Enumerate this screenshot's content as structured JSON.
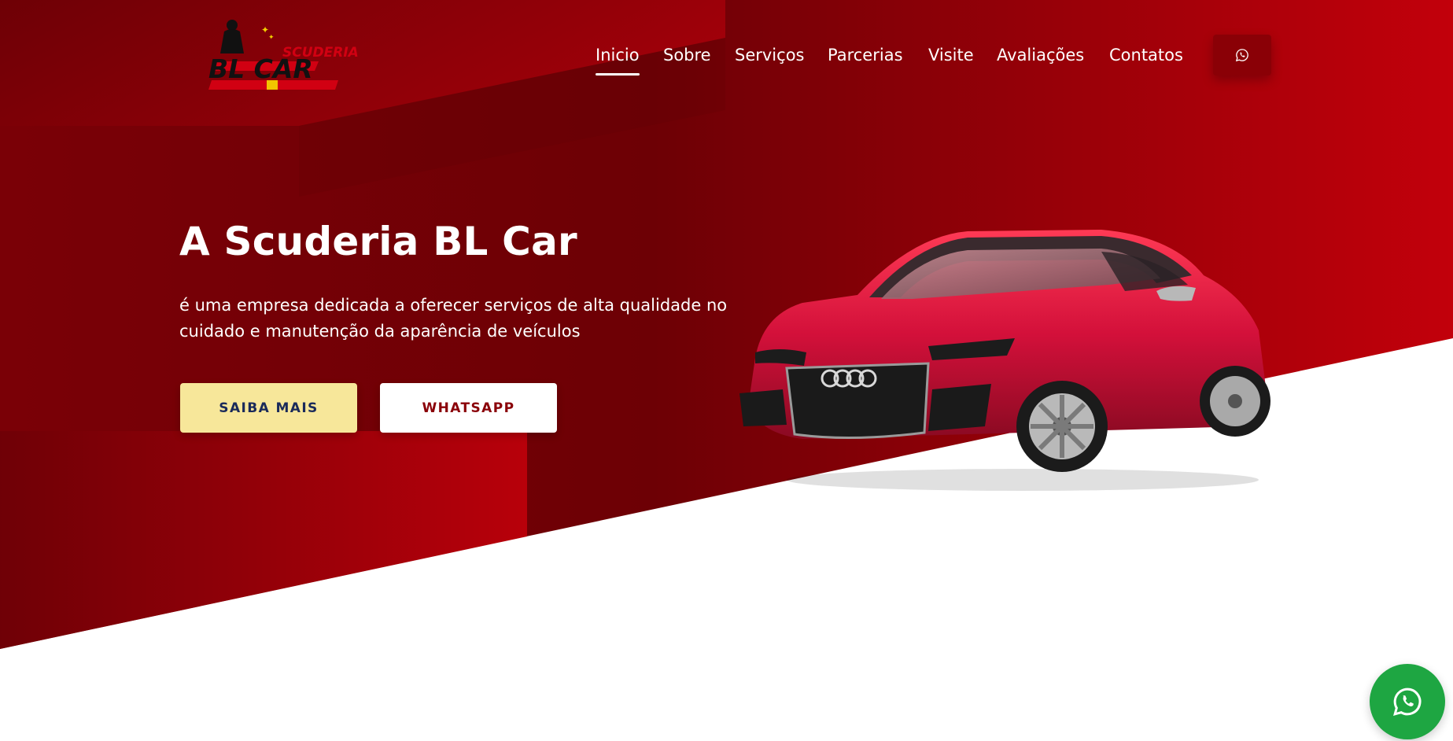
{
  "brand": {
    "logo_top_text": "SCUDERIA",
    "logo_main_text": "BL CAR"
  },
  "nav": {
    "items": [
      {
        "label": "Inicio",
        "active": true
      },
      {
        "label": "Sobre"
      },
      {
        "label": "Serviços"
      },
      {
        "label": "Parcerias"
      },
      {
        "label": "Visite"
      },
      {
        "label": "Avaliações"
      },
      {
        "label": "Contatos"
      }
    ],
    "whatsapp_icon": "whatsapp-icon"
  },
  "hero": {
    "title": "A Scuderia BL Car",
    "subtitle": "é uma empresa dedicada a oferecer serviços de alta qualidade no cuidado e manutenção da aparência de veículos",
    "btn_primary": "SAIBA MAIS",
    "btn_secondary": "WHATSAPP"
  },
  "floating": {
    "whatsapp_icon": "whatsapp-icon"
  },
  "colors": {
    "hero_dark": "#6e0006",
    "hero_bright": "#c4000c",
    "button_yellow": "#f7e79a",
    "whatsapp_green": "#1ea642"
  }
}
